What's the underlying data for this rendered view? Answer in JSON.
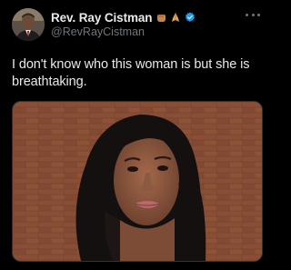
{
  "author": {
    "display_name": "Rev. Ray Cistman",
    "handle": "@RevRayCistman",
    "avatar_icon": "profile-photo",
    "badges": [
      "fist-emoji",
      "praying-hands-emoji",
      "verified-badge-icon"
    ]
  },
  "menu": {
    "icon": "more-options-icon"
  },
  "tweet": {
    "text": "I don't know who this woman is but she is breathtaking."
  },
  "media": {
    "type": "photo",
    "icon": "attached-photo"
  },
  "colors": {
    "background": "#000000",
    "text_primary": "#e7e9ea",
    "text_secondary": "#71767b",
    "verified_blue": "#1d9bf0"
  }
}
